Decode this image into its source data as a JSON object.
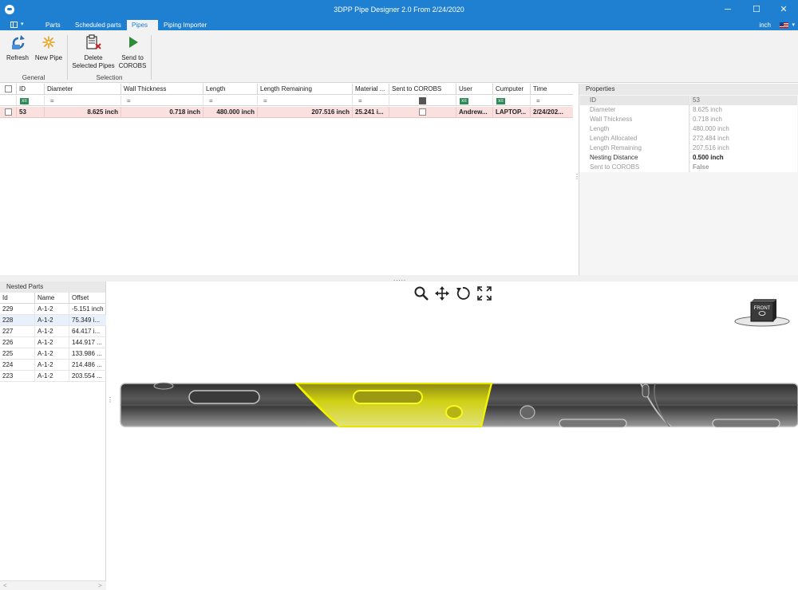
{
  "window": {
    "title": "3DPP Pipe Designer 2.0 From 2/24/2020",
    "minimize": "─",
    "maximize": "☐",
    "close": "✕"
  },
  "menu": {
    "tabs": [
      "Parts",
      "Scheduled parts",
      "Pipes",
      "Piping Importer"
    ],
    "active_tab": "Pipes",
    "unit": "inch"
  },
  "ribbon": {
    "refresh": "Refresh",
    "new_pipe": "New Pipe",
    "delete_line1": "Delete",
    "delete_line2": "Selected Pipes",
    "send_line1": "Send to",
    "send_line2": "COROBS",
    "group_general": "General",
    "group_selection": "Selection"
  },
  "grid": {
    "columns": [
      "ID",
      "Diameter",
      "Wall Thickness",
      "Length",
      "Length Remaining",
      "Material ...",
      "Sent to COROBS",
      "User",
      "Cumputer",
      "Time"
    ],
    "filter_symbol": "=",
    "filter_icon_text": "x≡",
    "row": {
      "id": "53",
      "diameter": "8.625 inch",
      "wall_thickness": "0.718 inch",
      "length": "480.000 inch",
      "length_remaining": "207.516 inch",
      "material": "25.241 i...",
      "user": "Andrew...",
      "computer": "LAPTOP...",
      "time": "2/24/202..."
    }
  },
  "properties": {
    "title": "Properties",
    "rows": [
      {
        "name": "ID",
        "value": "53"
      },
      {
        "name": "Diameter",
        "value": "8.625 inch"
      },
      {
        "name": "Wall Thickness",
        "value": "0.718 inch"
      },
      {
        "name": "Length",
        "value": "480.000 inch"
      },
      {
        "name": "Length Allocated",
        "value": "272.484 inch"
      },
      {
        "name": "Length Remaining",
        "value": "207.516 inch"
      },
      {
        "name": "Nesting Distance",
        "value": "0.500 inch"
      },
      {
        "name": "Sent to COROBS",
        "value": "False"
      }
    ]
  },
  "splitter": {
    "dots_h": ".....",
    "dots_v": "⋮"
  },
  "nested": {
    "title": "Nested Parts",
    "columns": [
      "Id",
      "Name",
      "Offset"
    ],
    "rows": [
      {
        "id": "229",
        "name": "A-1-2",
        "offset": "-5.151 inch"
      },
      {
        "id": "228",
        "name": "A-1-2",
        "offset": "75.349 i..."
      },
      {
        "id": "227",
        "name": "A-1-2",
        "offset": "64.417 i..."
      },
      {
        "id": "226",
        "name": "A-1-2",
        "offset": "144.917 ..."
      },
      {
        "id": "225",
        "name": "A-1-2",
        "offset": "133.986 ..."
      },
      {
        "id": "224",
        "name": "A-1-2",
        "offset": "214.486 ..."
      },
      {
        "id": "223",
        "name": "A-1-2",
        "offset": "203.554 ..."
      }
    ],
    "scroll_left": "<",
    "scroll_right": ">"
  },
  "viewport": {
    "viewcube_label": "FRONT",
    "tools": [
      "zoom-icon",
      "pan-icon",
      "rotate-icon",
      "fit-icon"
    ]
  }
}
